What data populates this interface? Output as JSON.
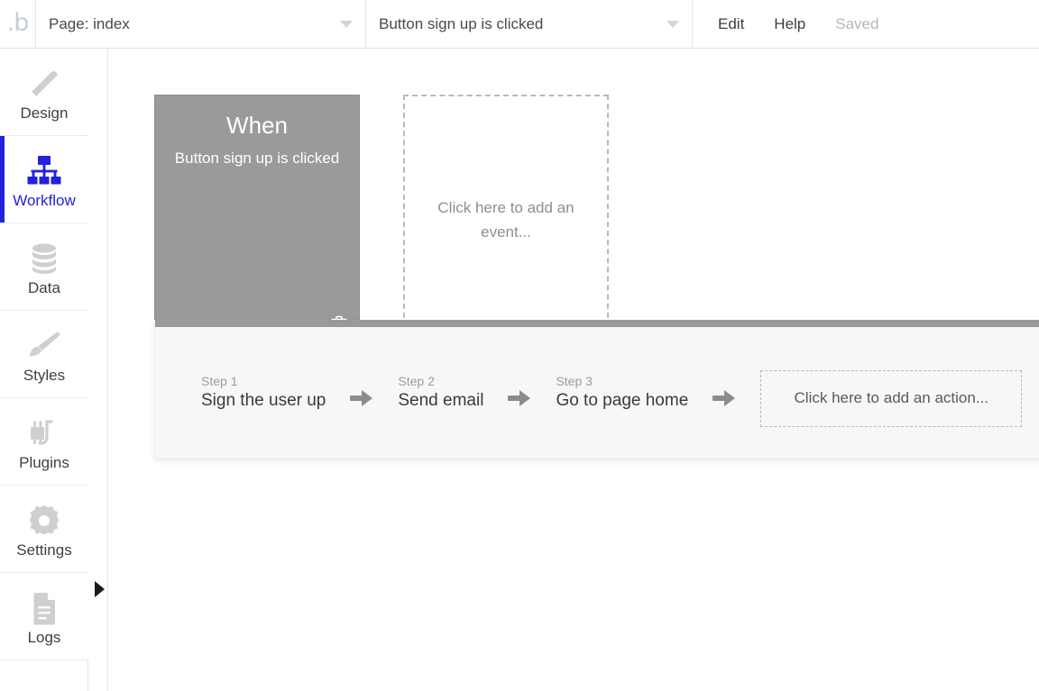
{
  "header": {
    "logo": "bubble-logo",
    "page_select": {
      "label": "Page: index",
      "caret": "chevron-down-icon"
    },
    "event_select": {
      "label": "Button sign up is clicked",
      "caret": "chevron-down-icon"
    },
    "actions": [
      {
        "label": "Edit",
        "muted": false
      },
      {
        "label": "Help",
        "muted": false
      },
      {
        "label": "Saved",
        "muted": true
      }
    ]
  },
  "sidebar": {
    "items": [
      {
        "label": "Design",
        "icon": "design-icon",
        "active": false
      },
      {
        "label": "Workflow",
        "icon": "workflow-icon",
        "active": true
      },
      {
        "label": "Data",
        "icon": "data-icon",
        "active": false
      },
      {
        "label": "Styles",
        "icon": "styles-icon",
        "active": false
      },
      {
        "label": "Plugins",
        "icon": "plugins-icon",
        "active": false
      },
      {
        "label": "Settings",
        "icon": "settings-icon",
        "active": false
      },
      {
        "label": "Logs",
        "icon": "logs-icon",
        "active": false
      }
    ],
    "expander": "expand-panel-arrow-icon"
  },
  "canvas": {
    "event_card": {
      "title": "When",
      "subtitle": "Button sign up is clicked",
      "delete_icon": "trash-icon"
    },
    "add_event_placeholder": "Click here to add an event...",
    "steps": [
      {
        "number": "Step 1",
        "name": "Sign the user up"
      },
      {
        "number": "Step 2",
        "name": "Send email"
      },
      {
        "number": "Step 3",
        "name": "Go to page home"
      }
    ],
    "add_action_placeholder": "Click here to add an action...",
    "step_arrow_icon": "arrow-right-icon"
  },
  "colors": {
    "accent_blue": "#2222dd",
    "event_card_gray": "#9a9a9a",
    "panel_gray": "#f7f7f7",
    "muted_text": "#b6b6b6"
  }
}
